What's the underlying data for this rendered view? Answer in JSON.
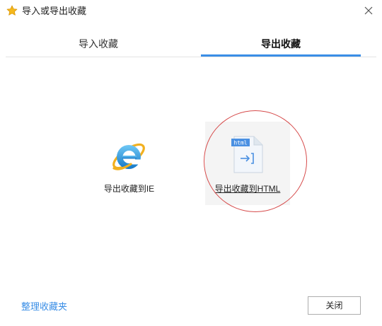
{
  "window": {
    "title": "导入或导出收藏",
    "title_icon": "star-icon",
    "close_icon": "close-icon"
  },
  "tabs": [
    {
      "label": "导入收藏",
      "active": false
    },
    {
      "label": "导出收藏",
      "active": true
    }
  ],
  "options": [
    {
      "label": "导出收藏到IE",
      "icon": "ie-icon"
    },
    {
      "label": "导出收藏到HTML",
      "icon": "html-file-icon",
      "icon_badge": "html"
    }
  ],
  "footer": {
    "manage_link": "整理收藏夹",
    "close_label": "关闭"
  },
  "colors": {
    "accent": "#3a8ee6",
    "highlight_circle": "#d64a4a",
    "star": "#f5b81c"
  }
}
